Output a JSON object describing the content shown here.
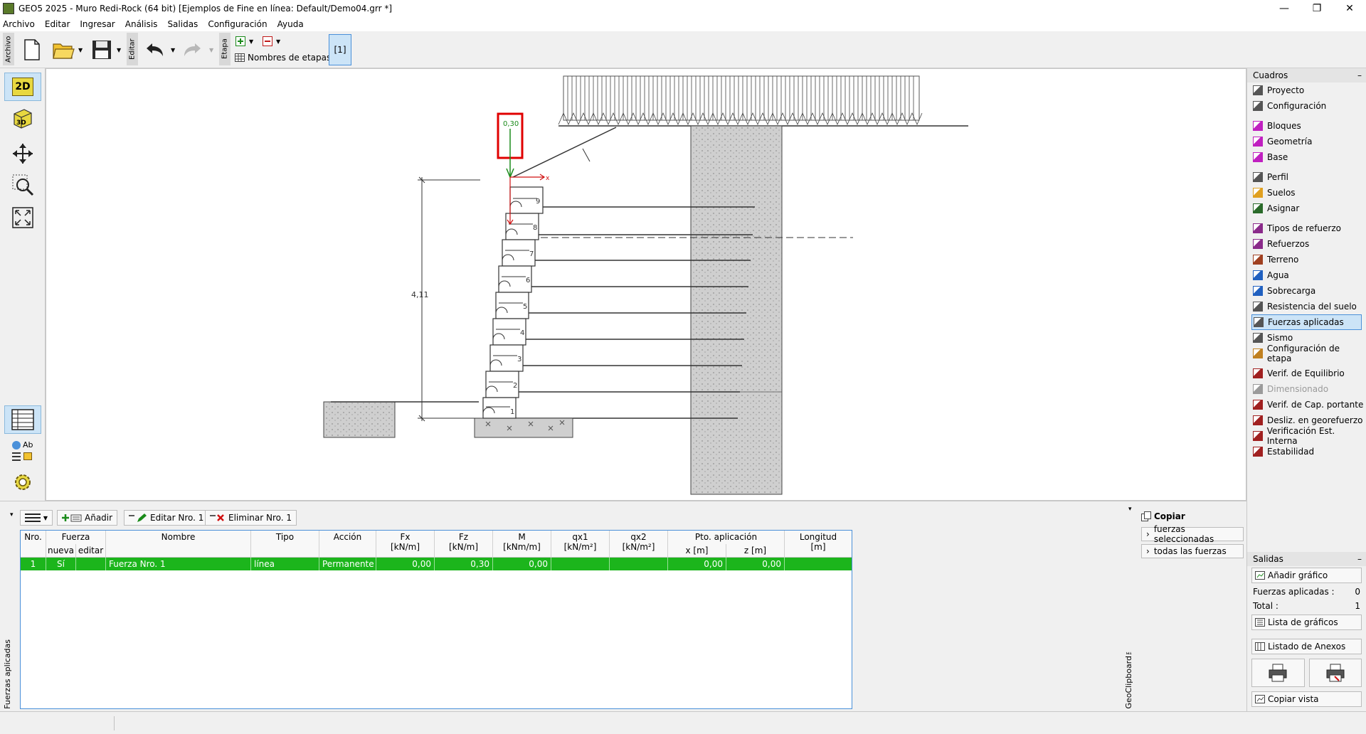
{
  "window": {
    "title": "GEO5 2025 - Muro Redi-Rock  (64 bit) [Ejemplos de Fine en línea: Default/Demo04.grr *]",
    "min": "—",
    "max": "❐",
    "close": "✕"
  },
  "menu": [
    "Archivo",
    "Editar",
    "Ingresar",
    "Análisis",
    "Salidas",
    "Configuración",
    "Ayuda"
  ],
  "toolbar": {
    "archivo_label": "Archivo",
    "editar_label": "Editar",
    "etapa_label": "Etapa",
    "stage_names_label": "Nombres de etapas",
    "stage_button": "[1]"
  },
  "lefttools": {
    "btn_2d": "2D",
    "btn_3d": "3D",
    "ab": "Ab"
  },
  "drawing": {
    "force_value": "0,30",
    "height_dim": "4,11",
    "block_numbers": [
      "9",
      "8",
      "7",
      "6",
      "5",
      "4",
      "3",
      "2",
      "1"
    ]
  },
  "frames": {
    "header": "Cuadros",
    "collapse": "–",
    "groups": [
      [
        {
          "label": "Proyecto",
          "icon": "document-icon",
          "color": "#555555"
        },
        {
          "label": "Configuración",
          "icon": "gear-icon",
          "color": "#555555"
        }
      ],
      [
        {
          "label": "Bloques",
          "icon": "blocks-icon",
          "color": "#c020c0"
        },
        {
          "label": "Geometría",
          "icon": "geometry-icon",
          "color": "#c020c0"
        },
        {
          "label": "Base",
          "icon": "base-icon",
          "color": "#c020c0"
        }
      ],
      [
        {
          "label": "Perfil",
          "icon": "profile-icon",
          "color": "#555555"
        },
        {
          "label": "Suelos",
          "icon": "soils-icon",
          "color": "#e0a020"
        },
        {
          "label": "Asignar",
          "icon": "assign-icon",
          "color": "#2a6a2a"
        }
      ],
      [
        {
          "label": "Tipos de refuerzo",
          "icon": "reinforcement-types-icon",
          "color": "#8a2a8a"
        },
        {
          "label": "Refuerzos",
          "icon": "reinforcements-icon",
          "color": "#8a2a8a"
        },
        {
          "label": "Terreno",
          "icon": "terrain-icon",
          "color": "#a04020"
        },
        {
          "label": "Agua",
          "icon": "water-icon",
          "color": "#2060c0"
        },
        {
          "label": "Sobrecarga",
          "icon": "surcharge-icon",
          "color": "#2060c0"
        },
        {
          "label": "Resistencia del suelo",
          "icon": "soil-resistance-icon",
          "color": "#555555"
        },
        {
          "label": "Fuerzas aplicadas",
          "icon": "applied-forces-icon",
          "color": "#555555"
        },
        {
          "label": "Sismo",
          "icon": "earthquake-icon",
          "color": "#555555"
        },
        {
          "label": "Configuración de etapa",
          "icon": "stage-settings-icon",
          "color": "#c08020"
        }
      ],
      [
        {
          "label": "Verif. de Equilibrio",
          "icon": "equilibrium-icon",
          "color": "#a02020"
        },
        {
          "label": "Dimensionado",
          "icon": "dimensioning-icon",
          "color": "#9a9a9a"
        },
        {
          "label": "Verif. de Cap. portante",
          "icon": "bearing-icon",
          "color": "#a02020"
        },
        {
          "label": "Desliz. en georefuerzo",
          "icon": "sliding-icon",
          "color": "#a02020"
        },
        {
          "label": "Verificación Est. Interna",
          "icon": "internal-stability-icon",
          "color": "#a02020"
        },
        {
          "label": "Estabilidad",
          "icon": "stability-icon",
          "color": "#a02020"
        }
      ]
    ],
    "selected": "Fuerzas aplicadas",
    "disabled": "Dimensionado"
  },
  "outputs": {
    "header": "Salidas",
    "collapse": "–",
    "add_chart": "Añadir gráfico",
    "applied_forces_label": "Fuerzas aplicadas :",
    "applied_forces_value": "0",
    "total_label": "Total :",
    "total_value": "1",
    "chart_list": "Lista de gráficos",
    "annex_list": "Listado de Anexos",
    "copy_view": "Copiar vista"
  },
  "bottom": {
    "side_label": "Fuerzas aplicadas",
    "add": "Añadir",
    "edit": "Editar Nro. 1",
    "delete": "Eliminar Nro. 1",
    "columns": [
      {
        "top": "Nro.",
        "bottom": ""
      },
      {
        "top": "Fuerza",
        "bottom": ""
      },
      {
        "top": "Nombre",
        "bottom": ""
      },
      {
        "top": "Tipo",
        "bottom": ""
      },
      {
        "top": "Acción",
        "bottom": ""
      },
      {
        "top": "Fx",
        "bottom": "[kN/m]"
      },
      {
        "top": "Fz",
        "bottom": "[kN/m]"
      },
      {
        "top": "M",
        "bottom": "[kNm/m]"
      },
      {
        "top": "qx1",
        "bottom": "[kN/m²]"
      },
      {
        "top": "qx2",
        "bottom": "[kN/m²]"
      },
      {
        "top": "Pto. aplicación",
        "bottom": ""
      },
      {
        "top": "Longitud",
        "bottom": "[m]"
      }
    ],
    "sub_nueva": "nueva",
    "sub_editar": "editar",
    "sub_x": "x [m]",
    "sub_z": "z [m]",
    "rows": [
      {
        "nro": "1",
        "nueva": "Sí",
        "editar": "",
        "nombre": "Fuerza Nro. 1",
        "tipo": "línea",
        "accion": "Permanente",
        "fx": "0,00",
        "fz": "0,30",
        "m": "0,00",
        "qx1": "",
        "qx2": "",
        "x": "0,00",
        "z": "0,00",
        "longitud": ""
      }
    ]
  },
  "clipboard": {
    "side_label": "GeoClipboard™",
    "title": "Copiar",
    "selected_forces": "fuerzas seleccionadas",
    "all_forces": "todas las fuerzas"
  }
}
